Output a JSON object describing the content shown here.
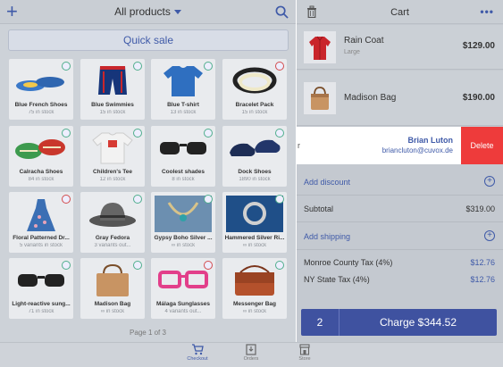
{
  "products_header": {
    "add": "+",
    "title": "All products"
  },
  "quick_sale": "Quick sale",
  "products": [
    {
      "name": "Blue French Shoes",
      "stock": "75 in stock",
      "icon": "flat-shoes-icon"
    },
    {
      "name": "Blue Swimmies",
      "stock": "15 in stock",
      "icon": "swim-trunks-icon"
    },
    {
      "name": "Blue T-shirt",
      "stock": "13 in stock",
      "icon": "tshirt-icon"
    },
    {
      "name": "Bracelet Pack",
      "stock": "15 in stock",
      "icon": "bracelet-icon"
    },
    {
      "name": "Calracha Shoes",
      "stock": "84 in stock",
      "icon": "espadrille-icon"
    },
    {
      "name": "Children's Tee",
      "stock": "12 in stock",
      "icon": "kids-tee-icon"
    },
    {
      "name": "Coolest shades",
      "stock": "8 in stock",
      "icon": "sunglasses-icon"
    },
    {
      "name": "Dock Shoes",
      "stock": "1890 in stock",
      "icon": "boat-shoes-icon"
    },
    {
      "name": "Floral Patterned Dr...",
      "stock": "5 variants in stock",
      "icon": "dress-icon"
    },
    {
      "name": "Gray Fedora",
      "stock": "3 variants out...",
      "icon": "fedora-icon"
    },
    {
      "name": "Gypsy Boho Silver ...",
      "stock": "∞ in stock",
      "icon": "necklace-icon"
    },
    {
      "name": "Hammered Silver Ri...",
      "stock": "∞ in stock",
      "icon": "ring-icon"
    },
    {
      "name": "Light-reactive sung...",
      "stock": "71 in stock",
      "icon": "sunglasses-icon"
    },
    {
      "name": "Madison Bag",
      "stock": "∞ in stock",
      "icon": "handbag-icon"
    },
    {
      "name": "Málaga Sunglasses",
      "stock": "4 variants out...",
      "icon": "pink-sunglasses-icon"
    },
    {
      "name": "Messenger Bag",
      "stock": "∞ in stock",
      "icon": "messenger-bag-icon"
    }
  ],
  "pagination": "Page 1 of 3",
  "cart": {
    "title": "Cart",
    "more": "•••",
    "items": [
      {
        "name": "Rain Coat",
        "variant": "Large",
        "price": "$129.00"
      },
      {
        "name": "Madison Bag",
        "variant": "",
        "price": "$190.00"
      }
    ],
    "customer": {
      "partial": "r",
      "name": "Brian Luton",
      "email": "briancluton@cuvox.de",
      "delete_label": "Delete"
    },
    "add_discount": "Add discount",
    "subtotal_label": "Subtotal",
    "subtotal_value": "$319.00",
    "add_shipping": "Add shipping",
    "taxes": [
      {
        "label": "Monroe County Tax (4%)",
        "value": "$12.76"
      },
      {
        "label": "NY State Tax (4%)",
        "value": "$12.76"
      }
    ],
    "quantity": "2",
    "charge_label": "Charge $344.52"
  },
  "nav": [
    {
      "label": "Checkout",
      "active": true
    },
    {
      "label": "Orders",
      "active": false
    },
    {
      "label": "Store",
      "active": false
    }
  ],
  "colors": {
    "accent": "#3f52a0",
    "delete": "#ee3b3b",
    "link": "#3f5aa8"
  }
}
